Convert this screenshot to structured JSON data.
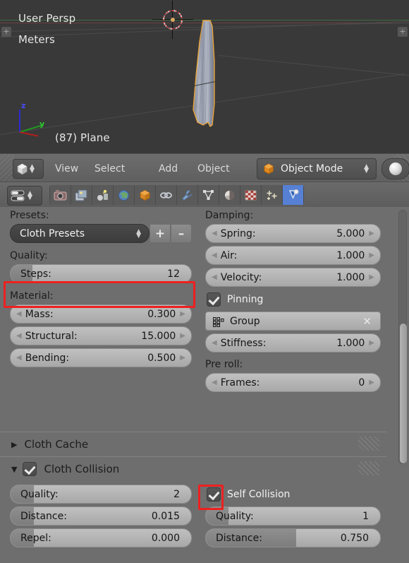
{
  "viewport": {
    "perspective_label": "User Persp",
    "unit_label": "Meters",
    "object_label": "(87) Plane",
    "axis_z": "z",
    "axis_y": "y",
    "bg_color": "#393939"
  },
  "view_header": {
    "editor_type_icon": "cube-icon",
    "menus": [
      "View",
      "Select",
      "Add",
      "Object"
    ],
    "mode": "Object Mode",
    "mode_icon": "object-cube-icon",
    "shading_icon": "solid-shading-sphere-icon"
  },
  "properties_header": {
    "editor_type_icon": "properties-sliders-icon",
    "tabs": [
      {
        "name": "render-tab",
        "icon": "camera-icon",
        "active": false
      },
      {
        "name": "render-layers-tab",
        "icon": "images-icon",
        "active": false
      },
      {
        "name": "scene-tab",
        "icon": "scene-icon",
        "active": false
      },
      {
        "name": "world-tab",
        "icon": "globe-icon",
        "active": false
      },
      {
        "name": "object-tab",
        "icon": "orange-cube-icon",
        "active": false
      },
      {
        "name": "constraints-tab",
        "icon": "chain-link-icon",
        "active": false
      },
      {
        "name": "modifiers-tab",
        "icon": "wrench-icon",
        "active": false
      },
      {
        "name": "object-data-tab",
        "icon": "mesh-triangle-icon",
        "active": false
      },
      {
        "name": "material-tab",
        "icon": "material-sphere-icon",
        "active": false
      },
      {
        "name": "texture-tab",
        "icon": "checker-texture-icon",
        "active": false
      },
      {
        "name": "particles-tab",
        "icon": "particles-icon",
        "active": false
      },
      {
        "name": "physics-tab",
        "icon": "physics-bounce-icon",
        "active": true
      }
    ]
  },
  "cloth_panel": {
    "presets_label": "Presets:",
    "preset_value": "Cloth Presets",
    "add_preset": "+",
    "remove_preset": "–",
    "quality_label": "Quality:",
    "steps": {
      "label": "Steps:",
      "value": "12",
      "fill_pct": 12,
      "highlighted": true
    },
    "material_label": "Material:",
    "material": [
      {
        "label": "Mass:",
        "value": "0.300"
      },
      {
        "label": "Structural:",
        "value": "15.000"
      },
      {
        "label": "Bending:",
        "value": "0.500"
      }
    ],
    "damping_label": "Damping:",
    "damping": [
      {
        "label": "Spring:",
        "value": "5.000"
      },
      {
        "label": "Air:",
        "value": "1.000"
      },
      {
        "label": "Velocity:",
        "value": "1.000"
      }
    ],
    "pinning": {
      "label": "Pinning",
      "checked": true
    },
    "group": {
      "label": "Group",
      "icon": "group-icon",
      "clear_icon": "x-close-icon"
    },
    "stiffness": {
      "label": "Stiffness:",
      "value": "1.000"
    },
    "preroll_label": "Pre roll:",
    "frames": {
      "label": "Frames:",
      "value": "0"
    }
  },
  "cloth_cache_panel": {
    "title": "Cloth Cache",
    "expanded": false,
    "triangle": "▶"
  },
  "cloth_collision_panel": {
    "title": "Cloth Collision",
    "expanded": true,
    "triangle": "▼",
    "checked": true,
    "object_collision": [
      {
        "label": "Quality:",
        "value": "2",
        "fill_pct": 13
      },
      {
        "label": "Distance:",
        "value": "0.015",
        "fill_pct": 13
      },
      {
        "label": "Repel:",
        "value": "0.000",
        "fill_pct": 13
      }
    ],
    "self_collision": {
      "label": "Self Collision",
      "checked": true,
      "highlighted": true
    },
    "self_quality": {
      "label": "Quality:",
      "value": "1",
      "fill_pct": 13
    },
    "self_distance": {
      "label": "Distance:",
      "value": "0.750",
      "fill_pct": 52
    }
  },
  "colors": {
    "panel_bg": "#6e6e6e",
    "viewport_bg": "#393939",
    "highlight": "#ef2020",
    "active_tab": "#5680d4"
  }
}
